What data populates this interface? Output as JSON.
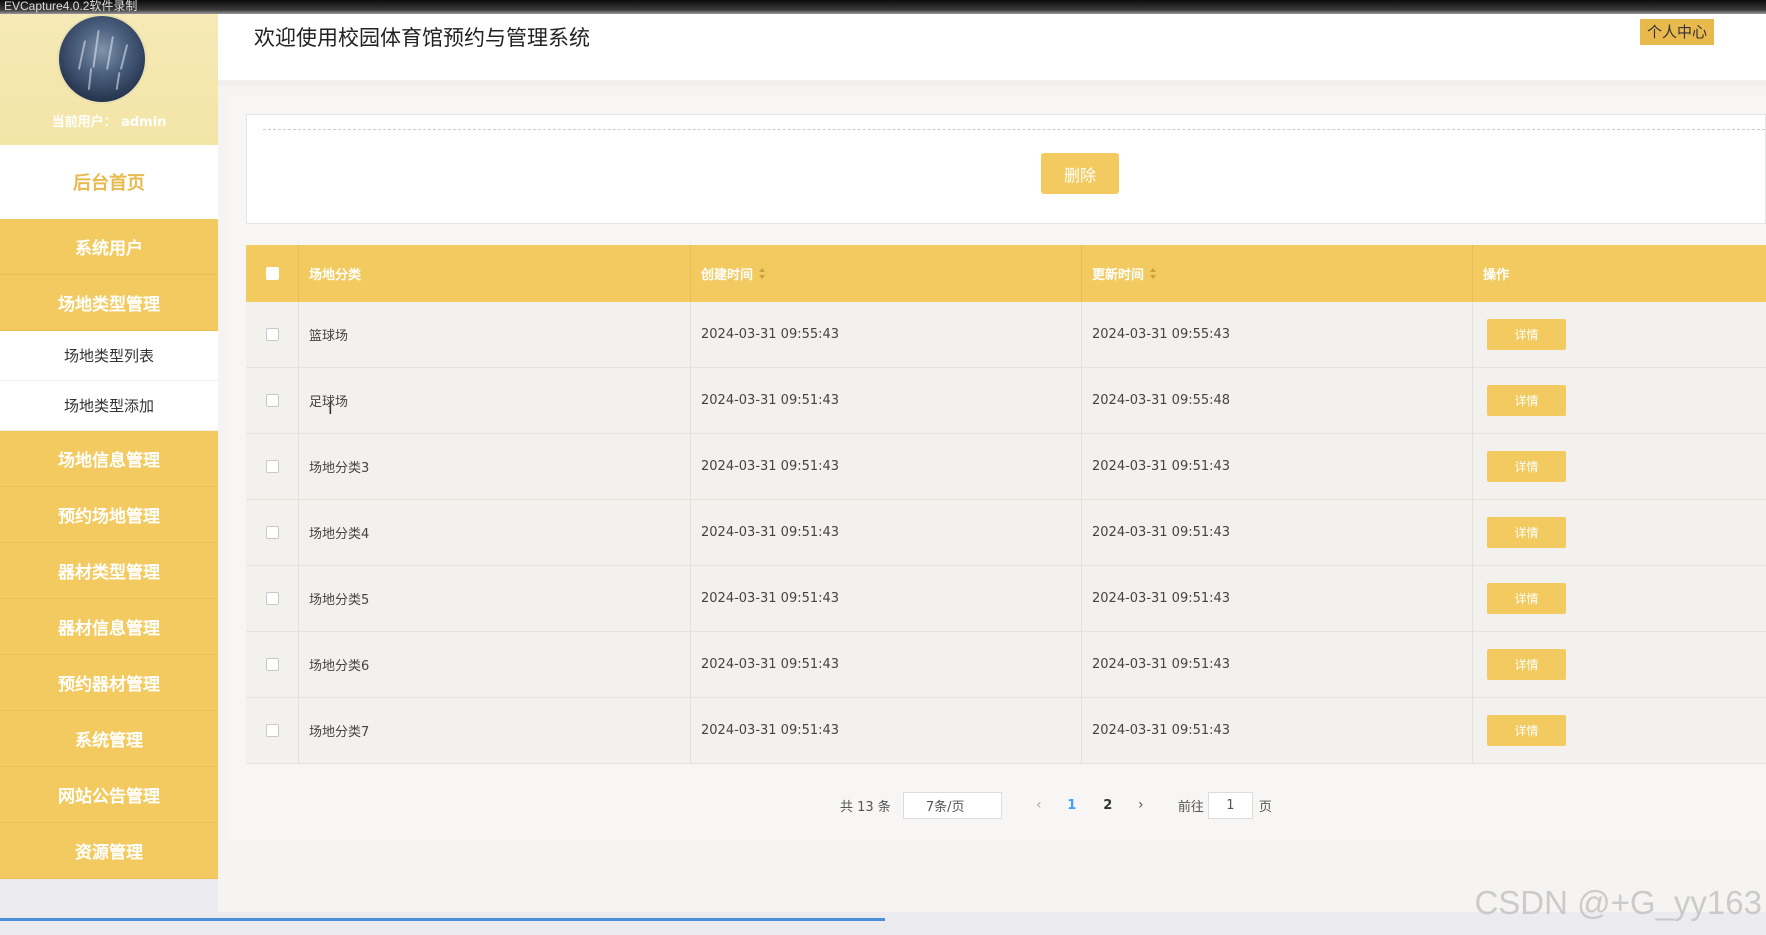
{
  "recorder": {
    "label": "EVCapture4.0.2软件录制"
  },
  "sidebar": {
    "current_user": "当前用户：  admin",
    "home": "后台首页",
    "items": [
      {
        "label": "系统用户"
      },
      {
        "label": "场地类型管理"
      },
      {
        "label": "场地类型列表",
        "sub": true
      },
      {
        "label": "场地类型添加",
        "sub": true
      },
      {
        "label": "场地信息管理"
      },
      {
        "label": "预约场地管理"
      },
      {
        "label": "器材类型管理"
      },
      {
        "label": "器材信息管理"
      },
      {
        "label": "预约器材管理"
      },
      {
        "label": "系统管理"
      },
      {
        "label": "网站公告管理"
      },
      {
        "label": "资源管理"
      }
    ]
  },
  "header": {
    "title": "欢迎使用校园体育馆预约与管理系统",
    "personal_center": "个人中心"
  },
  "toolbar": {
    "delete_label": "删除"
  },
  "table": {
    "columns": [
      "场地分类",
      "创建时间",
      "更新时间",
      "操作"
    ],
    "detail_label": "详情",
    "rows": [
      {
        "category": "篮球场",
        "created": "2024-03-31 09:55:43",
        "updated": "2024-03-31 09:55:43"
      },
      {
        "category": "足球场",
        "created": "2024-03-31 09:51:43",
        "updated": "2024-03-31 09:55:48"
      },
      {
        "category": "场地分类3",
        "created": "2024-03-31 09:51:43",
        "updated": "2024-03-31 09:51:43"
      },
      {
        "category": "场地分类4",
        "created": "2024-03-31 09:51:43",
        "updated": "2024-03-31 09:51:43"
      },
      {
        "category": "场地分类5",
        "created": "2024-03-31 09:51:43",
        "updated": "2024-03-31 09:51:43"
      },
      {
        "category": "场地分类6",
        "created": "2024-03-31 09:51:43",
        "updated": "2024-03-31 09:51:43"
      },
      {
        "category": "场地分类7",
        "created": "2024-03-31 09:51:43",
        "updated": "2024-03-31 09:51:43"
      }
    ]
  },
  "pagination": {
    "total": "共 13 条",
    "page_size": "7条/页",
    "pages": [
      "1",
      "2"
    ],
    "current": "1",
    "goto_prefix": "前往",
    "goto_value": "1",
    "goto_suffix": "页",
    "prev_icon": "‹",
    "next_icon": "›"
  },
  "watermark": "CSDN @+G_yy163",
  "colors": {
    "accent": "#f2ca5f",
    "accent_dark": "#e8b94d",
    "link": "#409eff"
  }
}
